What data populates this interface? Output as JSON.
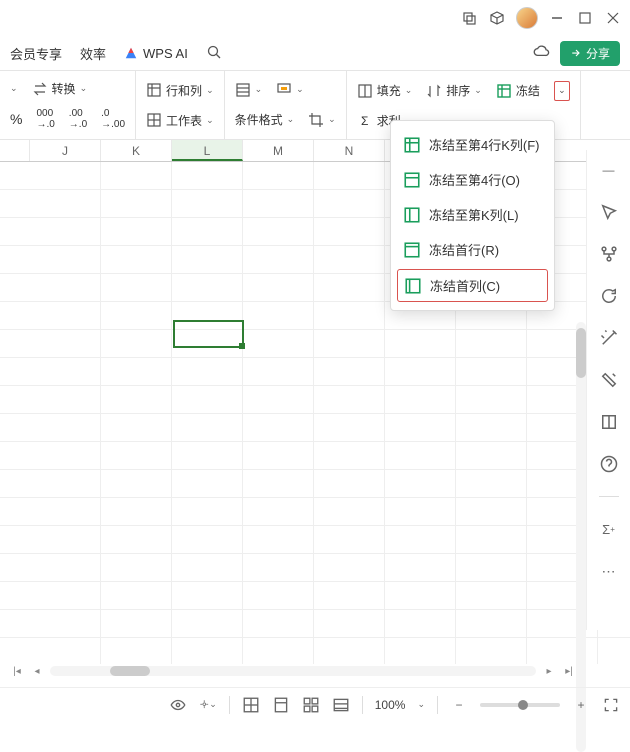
{
  "titlebar": {
    "minimize": "—",
    "close": "✕"
  },
  "menubar": {
    "member": "会员专享",
    "efficiency": "效率",
    "ai_label": "WPS AI",
    "share": "分享"
  },
  "toolbar": {
    "convert": "转换",
    "rowcol": "行和列",
    "worksheet": "工作表",
    "condfmt": "条件格式",
    "fill": "填充",
    "sort": "排序",
    "freeze": "冻结",
    "sum": "求利",
    "percent": "%",
    "dec1": ".00",
    "dec2": ".0",
    "dec3": ".00"
  },
  "col_headers": [
    "",
    "J",
    "K",
    "L",
    "M",
    "N",
    ""
  ],
  "active_col_index": 3,
  "dropdown": {
    "items": [
      {
        "label": "冻结至第4行K列(F)"
      },
      {
        "label": "冻结至第4行(O)"
      },
      {
        "label": "冻结至第K列(L)"
      },
      {
        "label": "冻结首行(R)"
      },
      {
        "label": "冻结首列(C)",
        "highlight": true
      }
    ]
  },
  "statusbar": {
    "zoom": "100%"
  }
}
